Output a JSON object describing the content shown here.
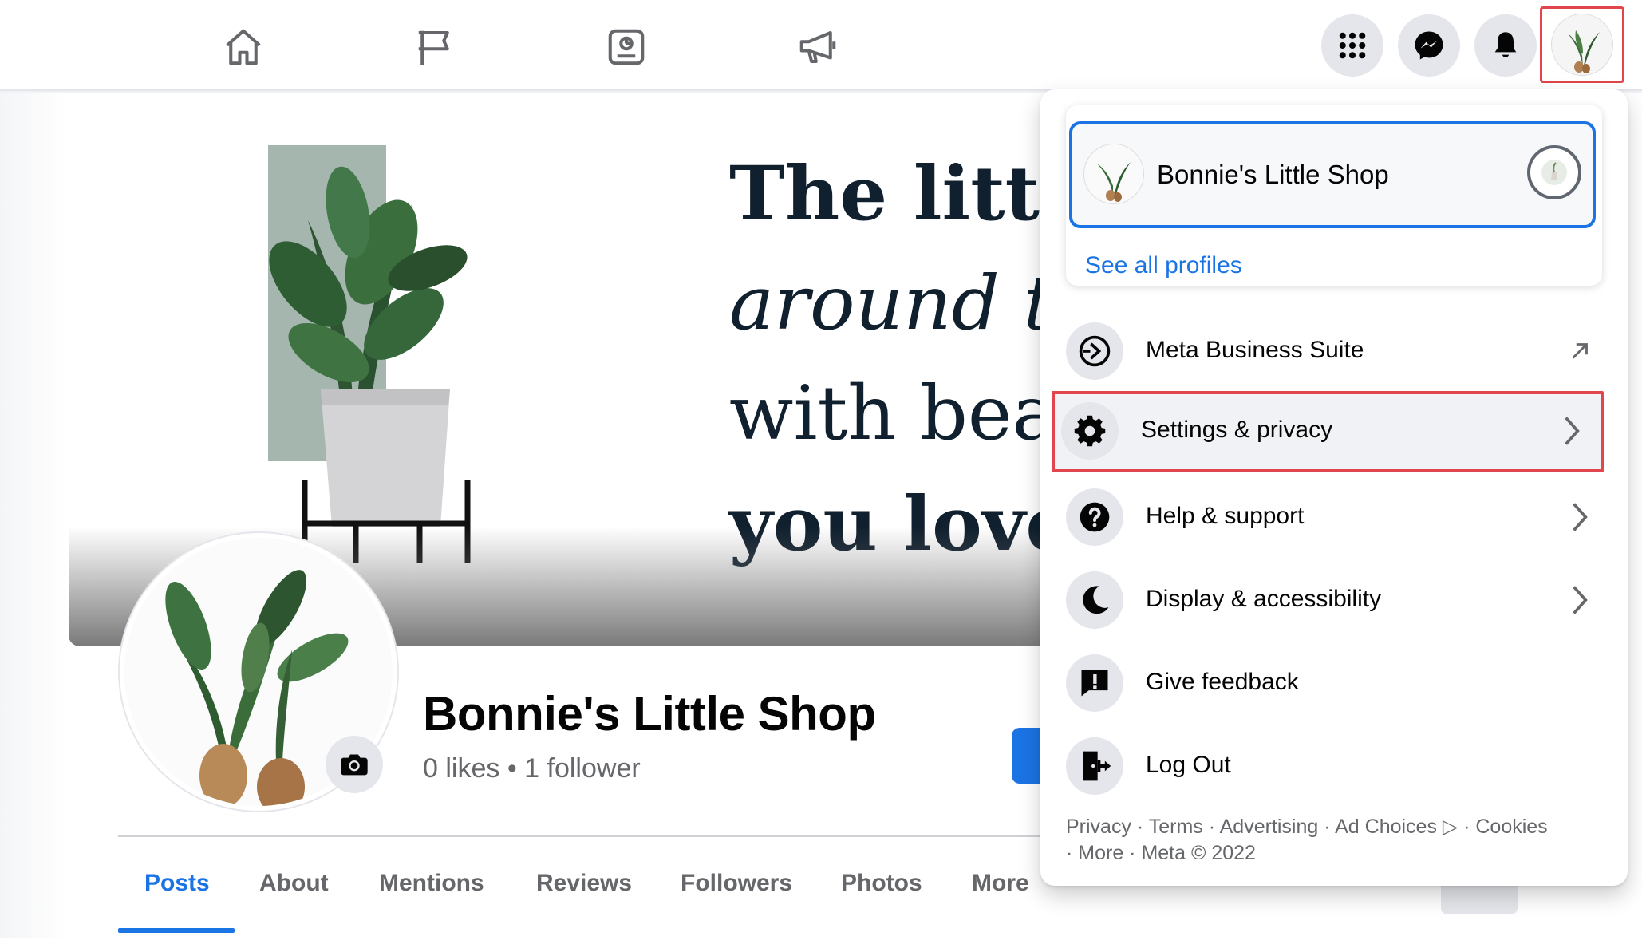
{
  "topbar": {
    "nav": [
      {
        "name": "home-icon"
      },
      {
        "name": "flag-icon"
      },
      {
        "name": "insights-icon"
      },
      {
        "name": "megaphone-icon"
      }
    ],
    "buttons": [
      {
        "name": "menu-grid-icon"
      },
      {
        "name": "messenger-icon"
      },
      {
        "name": "bell-icon"
      }
    ]
  },
  "cover": {
    "lines": [
      "The little",
      "around th",
      "with beau",
      "you love"
    ]
  },
  "page": {
    "name": "Bonnie's Little Shop",
    "stats": "0 likes • 1 follower"
  },
  "tabs": [
    "Posts",
    "About",
    "Mentions",
    "Reviews",
    "Followers",
    "Photos",
    "More"
  ],
  "menu": {
    "profile_name": "Bonnie's Little Shop",
    "see_all": "See all profiles",
    "items": [
      {
        "label": "Meta Business Suite",
        "icon": "business-suite-icon",
        "trailing": "external-arrow-icon"
      },
      {
        "label": "Settings & privacy",
        "icon": "gear-icon",
        "trailing": "chevron-right-icon"
      },
      {
        "label": "Help & support",
        "icon": "question-icon",
        "trailing": "chevron-right-icon"
      },
      {
        "label": "Display & accessibility",
        "icon": "moon-icon",
        "trailing": "chevron-right-icon"
      },
      {
        "label": "Give feedback",
        "icon": "feedback-icon",
        "trailing": ""
      },
      {
        "label": "Log Out",
        "icon": "logout-icon",
        "trailing": ""
      }
    ],
    "footer": {
      "line1": "Privacy · Terms · Advertising · Ad Choices ▷ · Cookies",
      "line2": "· More · Meta © 2022"
    }
  },
  "colors": {
    "accent": "#1b74e4",
    "highlight": "#e0464b",
    "secondary_text": "#65676b"
  }
}
